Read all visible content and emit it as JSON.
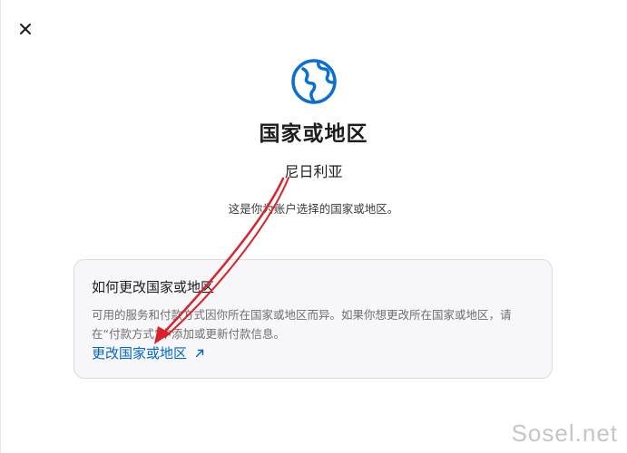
{
  "dialog": {
    "close_icon": "close-icon",
    "header_icon": "globe-icon",
    "title": "国家或地区",
    "country": "尼日利亚",
    "description": "这是你为账户选择的国家或地区。"
  },
  "info_card": {
    "title": "如何更改国家或地区",
    "body": "可用的服务和付款方式因你所在国家或地区而异。如果你想更改所在国家或地区，请在“付款方式”中添加或更新付款信息。",
    "link_label": "更改国家或地区",
    "link_icon": "external-link-icon"
  },
  "annotation": {
    "arrow_color": "#d9232a"
  },
  "watermark": "Sosel.net",
  "colors": {
    "accent": "#0066cc",
    "card_bg": "#f7f7f9"
  }
}
